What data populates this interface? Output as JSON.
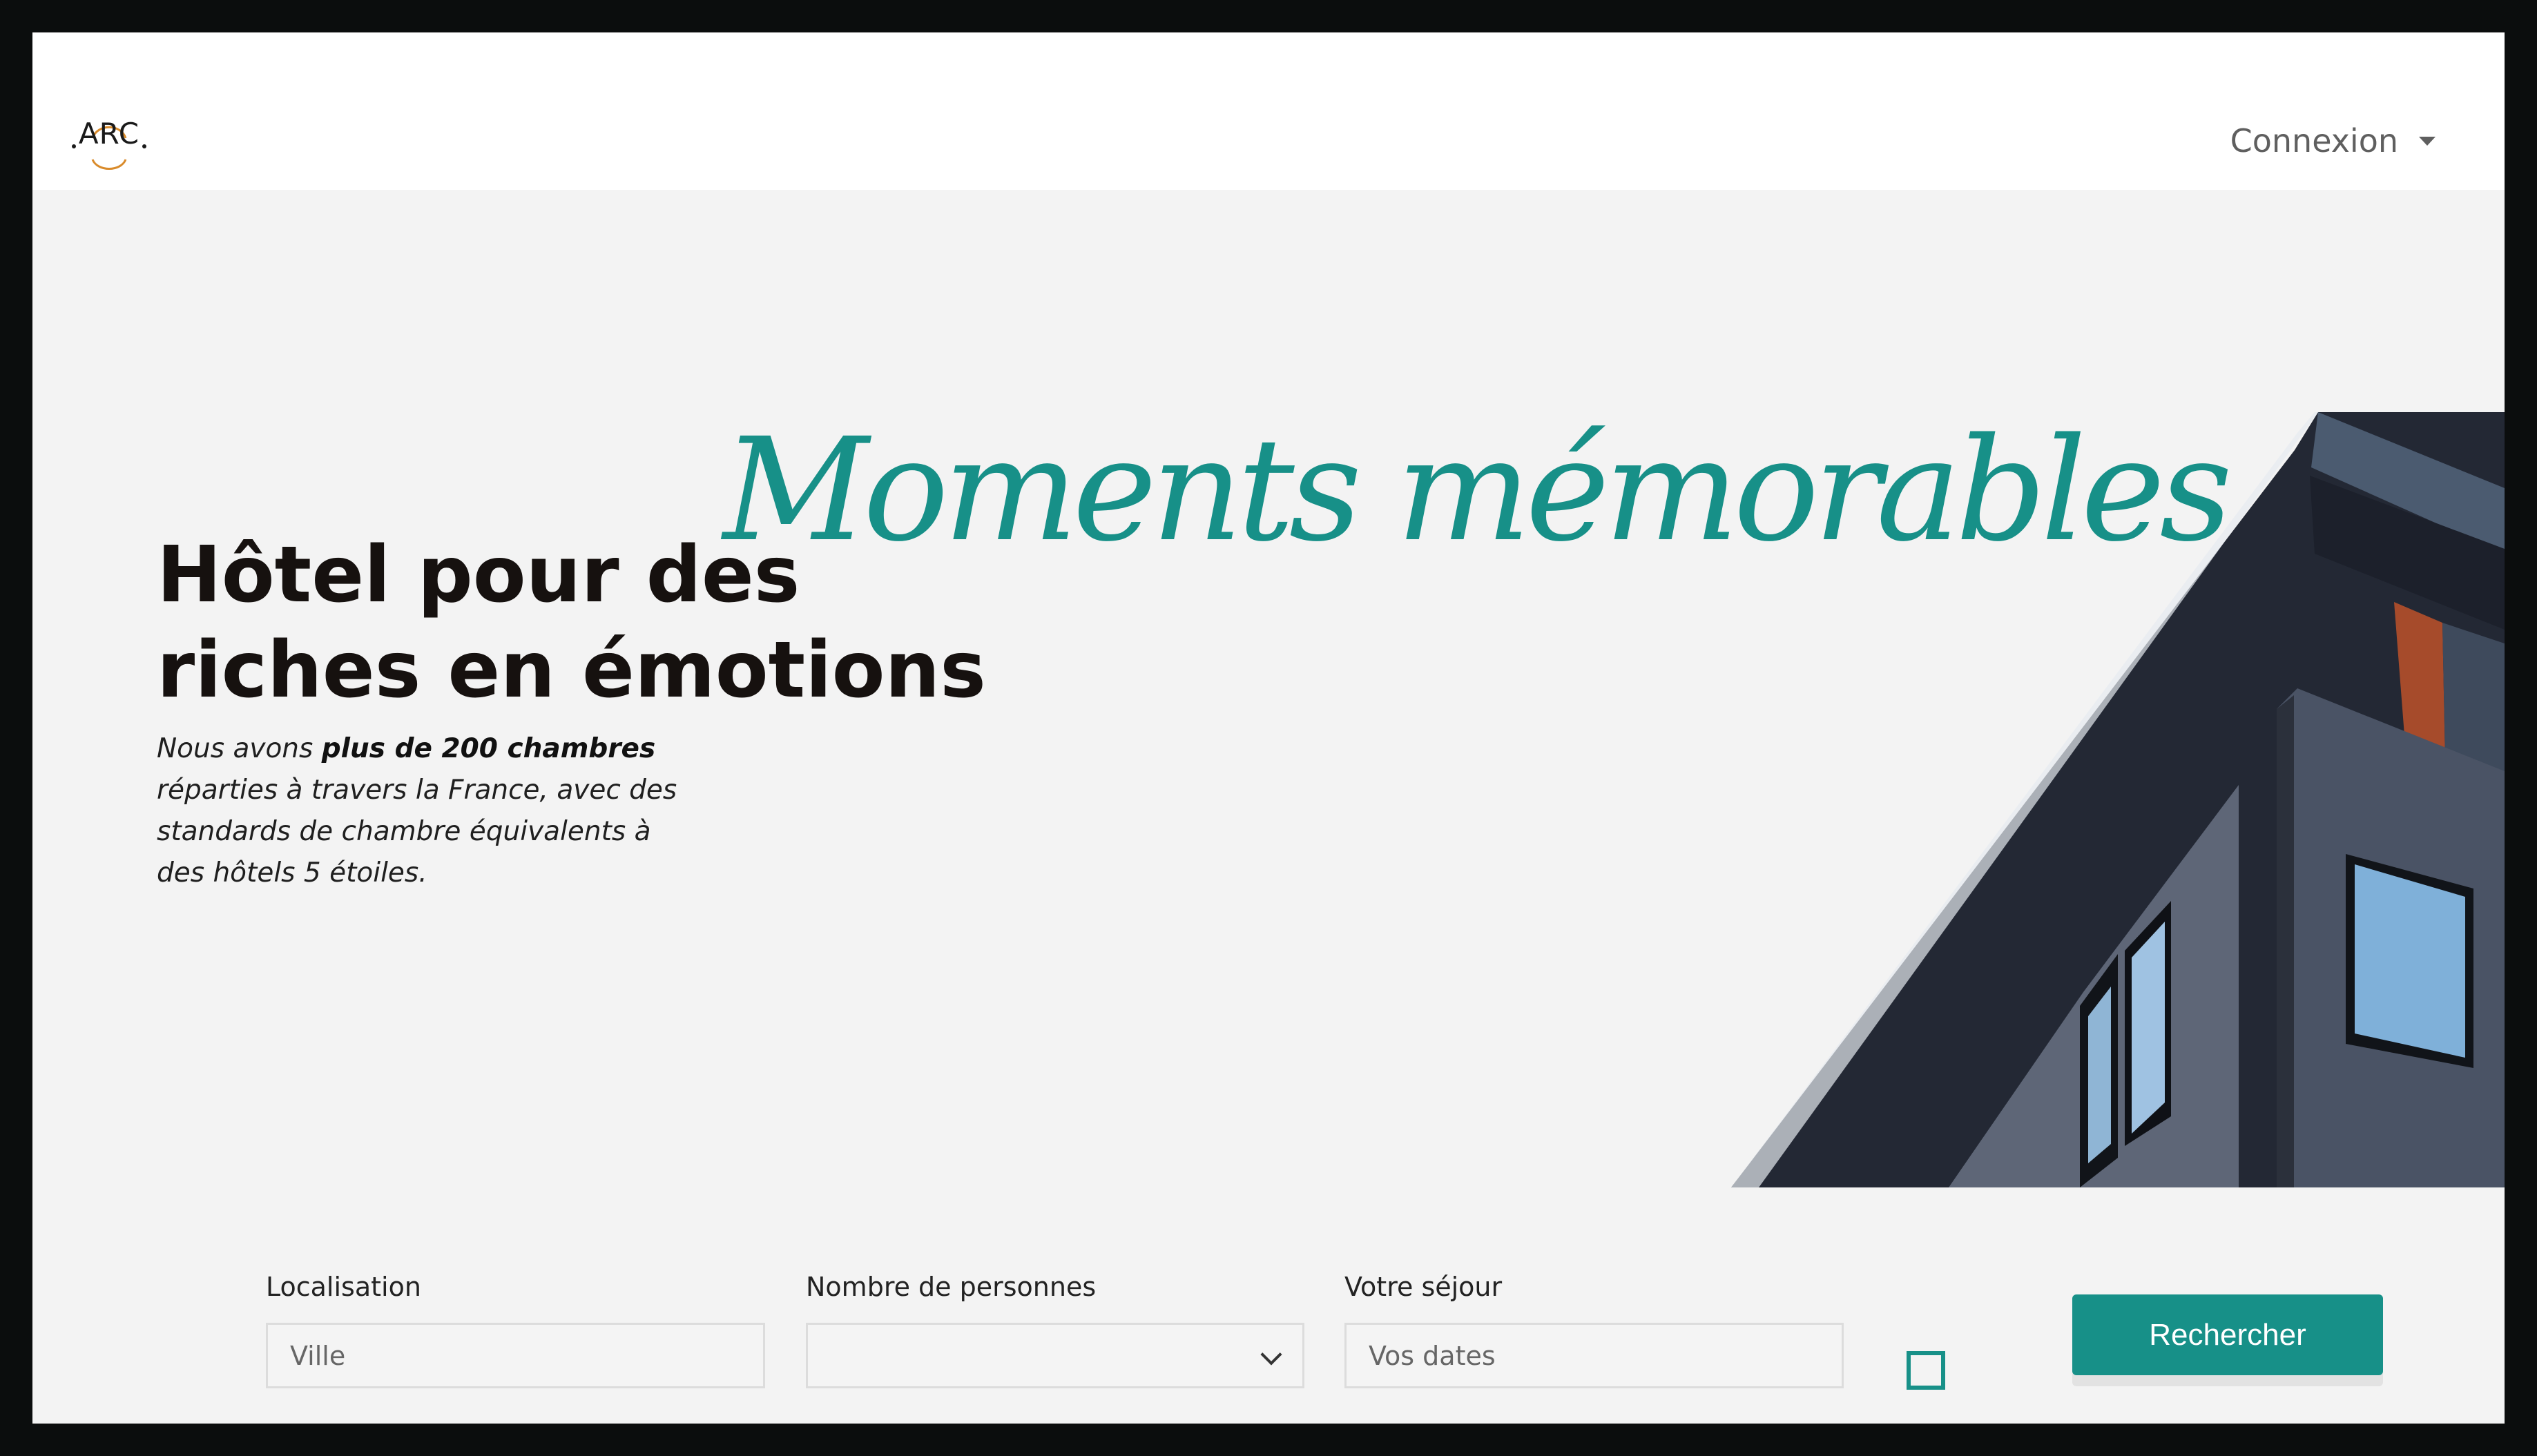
{
  "header": {
    "logo_text": "ARC",
    "login_label": "Connexion"
  },
  "hero": {
    "headline_line1": "Hôtel pour des",
    "headline_line2": "riches en émotions",
    "script_text": "Moments mémorables",
    "intro_part1": "Nous avons ",
    "intro_bold": "plus de 200 chambres",
    "intro_part2": "réparties à travers la France, avec des standards de chambre équivalents à des hôtels 5 étoiles."
  },
  "search": {
    "location_label": "Localisation",
    "location_placeholder": "Ville",
    "people_label": "Nombre de personnes",
    "people_value": "",
    "stay_label": "Votre séjour",
    "stay_placeholder": "Vos dates",
    "search_button": "Rechercher"
  },
  "colors": {
    "accent": "#179088",
    "background": "#f3f3f3",
    "header": "#ffffff",
    "frame": "#0b0d0d"
  },
  "icons": [
    "arc-logo-icon",
    "caret-down-icon",
    "chevron-down-icon",
    "checkbox-icon"
  ]
}
